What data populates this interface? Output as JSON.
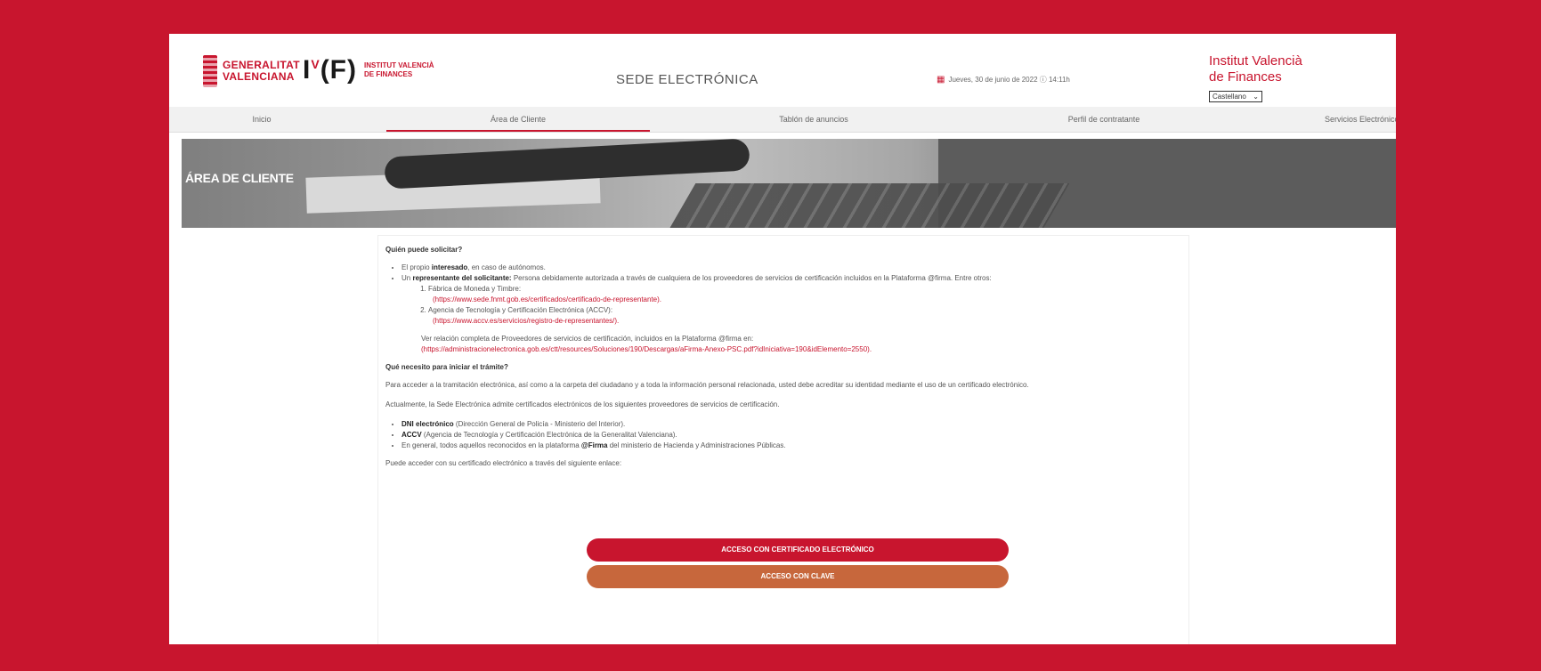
{
  "header": {
    "gva_name_line1": "GENERALITAT",
    "gva_name_line2": "VALENCIANA",
    "ivf_mark": "I",
    "ivf_mark_sup": "V",
    "ivf_mark_rest": "(F)",
    "ivf_name_line1": "INSTITUT VALENCIÀ",
    "ivf_name_line2": "DE FINANCES",
    "sede_title": "SEDE ELECTRÓNICA",
    "date_text": "Jueves, 30 de junio de 2022 ⓘ 14:11h",
    "institute_line1": "Institut Valencià",
    "institute_line2": "de Finances",
    "language_selected": "Castellano"
  },
  "nav": {
    "items": [
      {
        "label": "Inicio"
      },
      {
        "label": "Área de Cliente"
      },
      {
        "label": "Tablón de anuncios"
      },
      {
        "label": "Perfil de contratante"
      },
      {
        "label": "Servicios Electrónicos"
      }
    ]
  },
  "hero": {
    "title": "ÁREA DE CLIENTE"
  },
  "content": {
    "q1": "Quién puede solicitar?",
    "b1_pre": "El propio ",
    "b1_bold": "interesado",
    "b1_post": ", en caso de autónomos.",
    "b2_pre": "Un ",
    "b2_bold": "representante del solicitante:",
    "b2_post": " Persona debidamente autorizada a través de cualquiera de los proveedores de servicios de certificación incluidos en la Plataforma @firma. Entre otros:",
    "o1_label": "Fábrica de Moneda y Timbre:",
    "o1_link": "(https://www.sede.fnmt.gob.es/certificados/certificado-de-representante).",
    "o2_label": "Agencia de Tecnología y Certificación Electrónica (ACCV):",
    "o2_link": "(https://www.accv.es/servicios/registro-de-representantes/).",
    "ver_text": "Ver relación completa de Proveedores de servicios de certificación, incluidos en la Plataforma @firma en:",
    "ver_link": "(https://administracionelectronica.gob.es/ctt/resources/Soluciones/190/Descargas/aFirma-Anexo-PSC.pdf?idIniciativa=190&idElemento=2550).",
    "q2": "Qué necesito para iniciar el trámite?",
    "p1": "Para acceder a la tramitación electrónica, así como a la carpeta del ciudadano y a toda la información personal relacionada, usted debe acreditar su identidad mediante el uso de un certificado electrónico.",
    "p2": "Actualmente, la Sede Electrónica admite certificados electrónicos de los siguientes proveedores de servicios de certificación.",
    "c1_bold": "DNI electrónico",
    "c1_post": " (Dirección General de Policía - Ministerio del Interior).",
    "c2_bold": "ACCV",
    "c2_post": " (Agencia de Tecnología y Certificación Electrónica de la Generalitat Valenciana).",
    "c3_pre": "En general, todos aquellos reconocidos en la plataforma ",
    "c3_bold": "@Firma",
    "c3_post": " del ministerio de Hacienda y Administraciones Públicas.",
    "p3": "Puede acceder con su certificado electrónico a través del siguiente enlace:"
  },
  "buttons": {
    "certificado": "ACCESO CON CERTIFICADO ELECTRÓNICO",
    "clave": "ACCESO CON CLAVE"
  },
  "colors": {
    "brand": "#c8152e",
    "orange": "#c7673c"
  }
}
